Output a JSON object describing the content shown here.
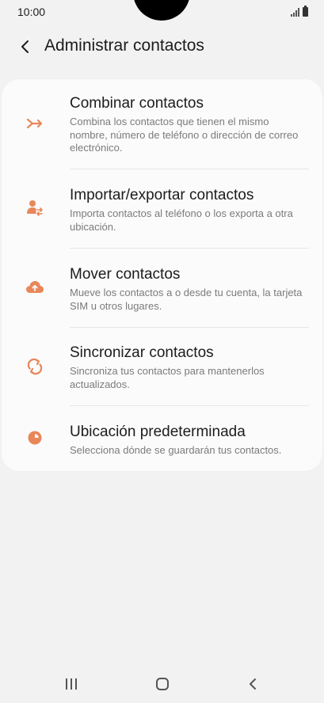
{
  "status_bar": {
    "time": "10:00"
  },
  "header": {
    "title": "Administrar contactos"
  },
  "colors": {
    "accent": "#e8875a",
    "title_text": "#1c1c1c",
    "secondary_text": "#7b7b7b",
    "background": "#f2f2f2",
    "card": "#fbfbfb"
  },
  "items": [
    {
      "icon": "merge-icon",
      "title": "Combinar contactos",
      "description": "Combina los contactos que tienen el mismo nombre, número de teléfono o dirección de correo electrónico."
    },
    {
      "icon": "import-export-icon",
      "title": "Importar/exportar contactos",
      "description": "Importa contactos al teléfono o los exporta a otra ubicación."
    },
    {
      "icon": "cloud-upload-icon",
      "title": "Mover contactos",
      "description": "Mueve los contactos a o desde tu cuenta, la tarjeta SIM u otros lugares."
    },
    {
      "icon": "sync-icon",
      "title": "Sincronizar contactos",
      "description": "Sincroniza tus contactos para mantenerlos actualizados."
    },
    {
      "icon": "pie-chart-icon",
      "title": "Ubicación predeterminada",
      "description": "Selecciona dónde se guardarán tus contactos."
    }
  ],
  "nav_bar": {
    "recents": "recents-icon",
    "home": "home-icon",
    "back": "back-icon"
  }
}
